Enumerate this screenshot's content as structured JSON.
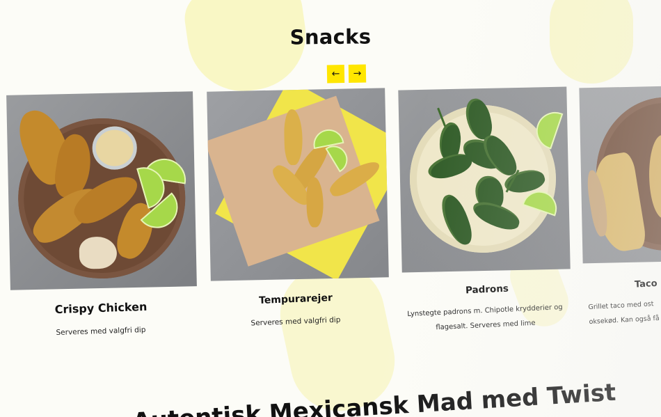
{
  "section": {
    "title": "Snacks",
    "prev_icon": "←",
    "next_icon": "→"
  },
  "cards": [
    {
      "name": "Crispy Chicken",
      "description": "Serveres med valgfri dip"
    },
    {
      "name": "Tempurarejer",
      "description": "Serveres med valgfri dip"
    },
    {
      "name": "Padrons",
      "description": "Lynstegte padrons m. Chipotle krydderier og flagesalt. Serveres med lime"
    },
    {
      "name": "Taco",
      "description": "Grillet taco med ost oksekød. Kan også få"
    }
  ],
  "next_section": {
    "title": "Autentisk Mexicansk Mad med Twist"
  },
  "colors": {
    "accent": "#ffe600",
    "background_blob": "#f6f29d"
  }
}
